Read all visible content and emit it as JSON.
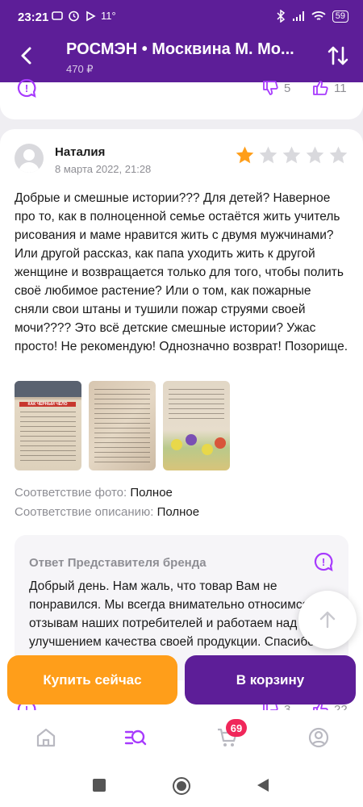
{
  "status_bar": {
    "time": "23:21",
    "temperature": "11°",
    "battery": "59"
  },
  "header": {
    "title": "РОСМЭН • Москвина М. Мо...",
    "price": "470 ₽"
  },
  "previous_review": {
    "dislikes": "5",
    "likes": "11"
  },
  "review": {
    "author": "Наталия",
    "date": "8 марта 2022, 21:28",
    "rating": 1,
    "rating_max": 5,
    "text": "Добрые и смешные истории??? Для детей? Наверное про то, как в полноценной семье остаётся жить учитель рисования и маме нравится жить с двумя мужчинами? Или другой рассказ, как папа уходить жить к другой женщине и возвращается только для того, чтобы полить своё любимое растение? Или о том, как пожарные сняли свои штаны и тушили пожар струями своей мочи???? Это всё детские смешные истории? Ужас просто! Не рекомендую! Однозначно возврат! Позорище.",
    "photo_page_title": "КАК ЧЕРНЫЙ ЧЕЛО",
    "photo_match_label": "Соответствие фото:",
    "photo_match_value": "Полное",
    "description_match_label": "Соответствие описанию:",
    "description_match_value": "Полное",
    "dislikes": "3",
    "likes": "22"
  },
  "brand_answer": {
    "heading": "Ответ Представителя бренда",
    "text": "Добрый день. Нам жаль, что товар Вам не понравился. Мы всегда внимательно относимся к отзывам наших потребителей и работаем над улучшением качества своей продукции. Спасибо за Ваш отзыв!"
  },
  "actions": {
    "buy_now": "Купить сейчас",
    "add_to_cart": "В корзину"
  },
  "bottom_nav": {
    "cart_badge": "69"
  },
  "colors": {
    "brand": "#5d1e98",
    "accent": "#ff9e1a",
    "badge": "#f0275a",
    "star": "#ff9e1a"
  }
}
